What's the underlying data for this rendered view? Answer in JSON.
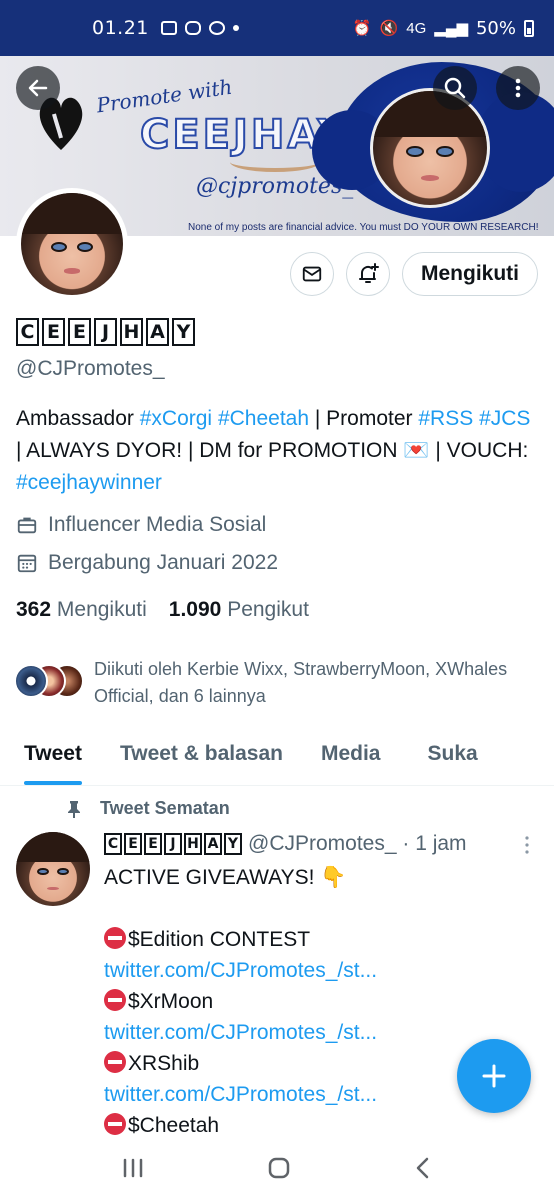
{
  "status": {
    "time": "01.21",
    "battery": "50%",
    "network": "4G"
  },
  "banner": {
    "script_text": "Promote with",
    "brand": "CEEJHAY",
    "handle_text": "@cjpromotes_",
    "disclaimer": "None of my posts are financial advice.  You must DO YOUR OWN RESEARCH!"
  },
  "profile": {
    "name_letters": [
      "C",
      "E",
      "E",
      "J",
      "H",
      "A",
      "Y"
    ],
    "handle": "@CJPromotes_",
    "bio": {
      "p1": "Ambassador ",
      "tag1": "#xCorgi",
      "tag2": "#Cheetah",
      "p2": " | Promoter ",
      "tag3": "#RSS",
      "tag4": "#JCS",
      "p3": " | ALWAYS DYOR! | DM for PROMOTION 💌 | VOUCH: ",
      "tag5": "#ceejhaywinner"
    },
    "category": "Influencer Media Sosial",
    "joined": "Bergabung Januari 2022",
    "following_count": "362",
    "following_label": "Mengikuti",
    "followers_count": "1.090",
    "followers_label": "Pengikut",
    "followed_by": "Diikuti oleh Kerbie Wixx, StrawberryMoon, XWhales Official, dan 6 lainnya",
    "follow_button": "Mengikuti"
  },
  "tabs": [
    "Tweet",
    "Tweet & balasan",
    "Media",
    "Suka"
  ],
  "pinned": {
    "label": "Tweet Sematan",
    "handle_time": "@CJPromotes_ · 1 jam",
    "lines": [
      "ACTIVE GIVEAWAYS! 👇",
      "$Edition CONTEST",
      "twitter.com/CJPromotes_/st...",
      "$XrMoon",
      "twitter.com/CJPromotes_/st...",
      "XRShib",
      "twitter.com/CJPromotes_/st...",
      "$Cheetah"
    ]
  },
  "colors": {
    "accent": "#1d9bf0",
    "statusbar": "#16307a",
    "muted": "#536471"
  }
}
